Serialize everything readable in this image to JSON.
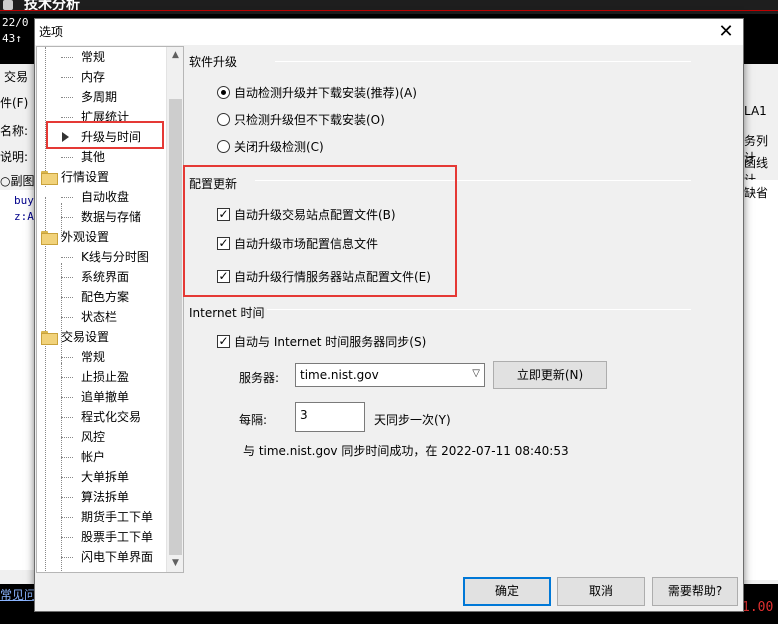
{
  "background": {
    "title": "技术分析",
    "code_top_1": "22/0",
    "code_top_2": "43↑",
    "left_labels": [
      "交易",
      "件(F)",
      "名称:",
      "说明:",
      "○副图"
    ],
    "code_lines": [
      "buy",
      "z:A"
    ],
    "right_labels": [
      "LA1",
      "务列计",
      "函线计",
      "缺省"
    ],
    "bottom_link": "常见问",
    "bottom_num": "1.00"
  },
  "dialog": {
    "title": "选项",
    "close_symbol": "✕",
    "tree": [
      {
        "label": "常规",
        "level": 1
      },
      {
        "label": "内存",
        "level": 1
      },
      {
        "label": "多周期",
        "level": 1
      },
      {
        "label": "扩展统计",
        "level": 1
      },
      {
        "label": "升级与时间",
        "level": 1,
        "selected": true
      },
      {
        "label": "其他",
        "level": 1
      },
      {
        "label": "行情设置",
        "level": 0
      },
      {
        "label": "自动收盘",
        "level": 1
      },
      {
        "label": "数据与存储",
        "level": 1
      },
      {
        "label": "外观设置",
        "level": 0
      },
      {
        "label": "K线与分时图",
        "level": 1
      },
      {
        "label": "系统界面",
        "level": 1
      },
      {
        "label": "配色方案",
        "level": 1
      },
      {
        "label": "状态栏",
        "level": 1
      },
      {
        "label": "交易设置",
        "level": 0
      },
      {
        "label": "常规",
        "level": 1
      },
      {
        "label": "止损止盈",
        "level": 1
      },
      {
        "label": "追单撤单",
        "level": 1
      },
      {
        "label": "程式化交易",
        "level": 1
      },
      {
        "label": "风控",
        "level": 1
      },
      {
        "label": "帐户",
        "level": 1
      },
      {
        "label": "大单拆单",
        "level": 1
      },
      {
        "label": "算法拆单",
        "level": 1
      },
      {
        "label": "期货手工下单",
        "level": 1
      },
      {
        "label": "股票手工下单",
        "level": 1
      },
      {
        "label": "闪电下单界面",
        "level": 1
      }
    ],
    "software_upgrade": {
      "title": "软件升级",
      "options": [
        {
          "label": "自动检测升级并下载安装(推荐)(A)",
          "selected": true
        },
        {
          "label": "只检测升级但不下载安装(O)",
          "selected": false
        },
        {
          "label": "关闭升级检测(C)",
          "selected": false
        }
      ]
    },
    "config_update": {
      "title": "配置更新",
      "options": [
        {
          "label": "自动升级交易站点配置文件(B)",
          "checked": true
        },
        {
          "label": "自动升级市场配置信息文件",
          "checked": true
        },
        {
          "label": "自动升级行情服务器站点配置文件(E)",
          "checked": true
        }
      ]
    },
    "internet_time": {
      "title": "Internet 时间",
      "sync_label": "自动与 Internet 时间服务器同步(S)",
      "sync_checked": true,
      "server_label": "服务器:",
      "server_value": "time.nist.gov",
      "update_now_button": "立即更新(N)",
      "interval_label": "每隔:",
      "interval_value": "3",
      "interval_suffix": "天同步一次(Y)",
      "status_text": "与 time.nist.gov 同步时间成功，在 2022-07-11 08:40:53"
    },
    "buttons": {
      "ok": "确定",
      "cancel": "取消",
      "help": "需要帮助?"
    },
    "colors": {
      "highlight": "#e53935",
      "default_button_border": "#0078d7"
    }
  }
}
